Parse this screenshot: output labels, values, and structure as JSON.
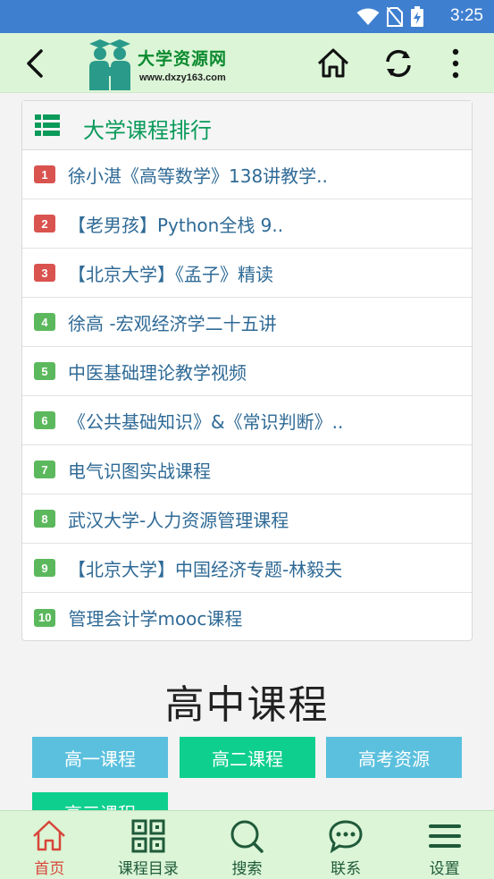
{
  "status_bar": {
    "time": "3:25"
  },
  "header": {
    "logo_title": "大学资源网",
    "logo_url": "www.dxzy163.com"
  },
  "ranking": {
    "title": "大学课程排行",
    "items": [
      {
        "rank": "1",
        "title": "徐小湛《高等数学》138讲教学.."
      },
      {
        "rank": "2",
        "title": "【老男孩】Python全栈 9.."
      },
      {
        "rank": "3",
        "title": "【北京大学】《孟子》精读"
      },
      {
        "rank": "4",
        "title": "徐高 -宏观经济学二十五讲"
      },
      {
        "rank": "5",
        "title": "中医基础理论教学视频"
      },
      {
        "rank": "6",
        "title": "《公共基础知识》&《常识判断》.."
      },
      {
        "rank": "7",
        "title": "电气识图实战课程"
      },
      {
        "rank": "8",
        "title": "武汉大学-人力资源管理课程"
      },
      {
        "rank": "9",
        "title": "【北京大学】中国经济专题-林毅夫"
      },
      {
        "rank": "10",
        "title": "管理会计学mooc课程"
      }
    ]
  },
  "high_school": {
    "title": "高中课程",
    "buttons": [
      "高一课程",
      "高二课程",
      "高考资源",
      "高三课程"
    ]
  },
  "tab_bar": {
    "tabs": [
      {
        "label": "首页",
        "icon": "home-icon"
      },
      {
        "label": "课程目录",
        "icon": "grid-icon"
      },
      {
        "label": "搜索",
        "icon": "search-icon"
      },
      {
        "label": "联系",
        "icon": "chat-icon"
      },
      {
        "label": "设置",
        "icon": "menu-icon"
      }
    ]
  },
  "colors": {
    "top_rank_badge": "#d9534f",
    "rank_badge": "#5cb85c",
    "accent_green": "#0a9a5a",
    "button_blue": "#5bc0de",
    "button_teal": "#0fcf8f",
    "active_tab": "#d8453a"
  }
}
